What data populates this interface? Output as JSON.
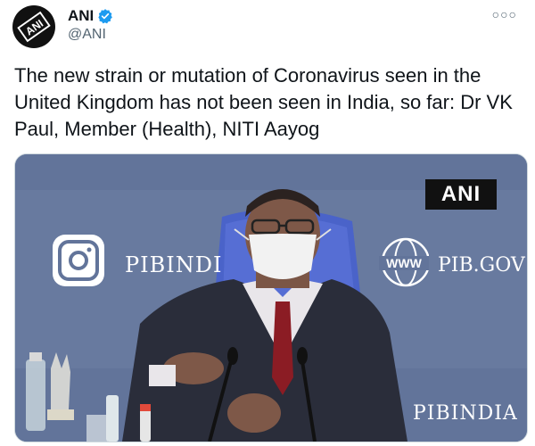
{
  "author": {
    "name": "ANI",
    "handle": "@ANI",
    "verified": true,
    "avatar_text": "ANI"
  },
  "menu_icon": "more-dots-icon",
  "tweet": {
    "text": "The new strain or mutation of Coronavirus seen in the United Kingdom has not been seen in India, so far: Dr VK Paul, Member (Health), NITI Aayog"
  },
  "media": {
    "watermark": "ANI",
    "backdrop_left": "PIBINDI",
    "backdrop_right": "PIB.GOV",
    "backdrop_bottom": "PIBINDIA",
    "backdrop_www": "WWW"
  },
  "colors": {
    "text": "#0f1419",
    "secondary": "#536471",
    "verified_blue": "#1d9bf0",
    "backdrop": "#6d80a2"
  }
}
